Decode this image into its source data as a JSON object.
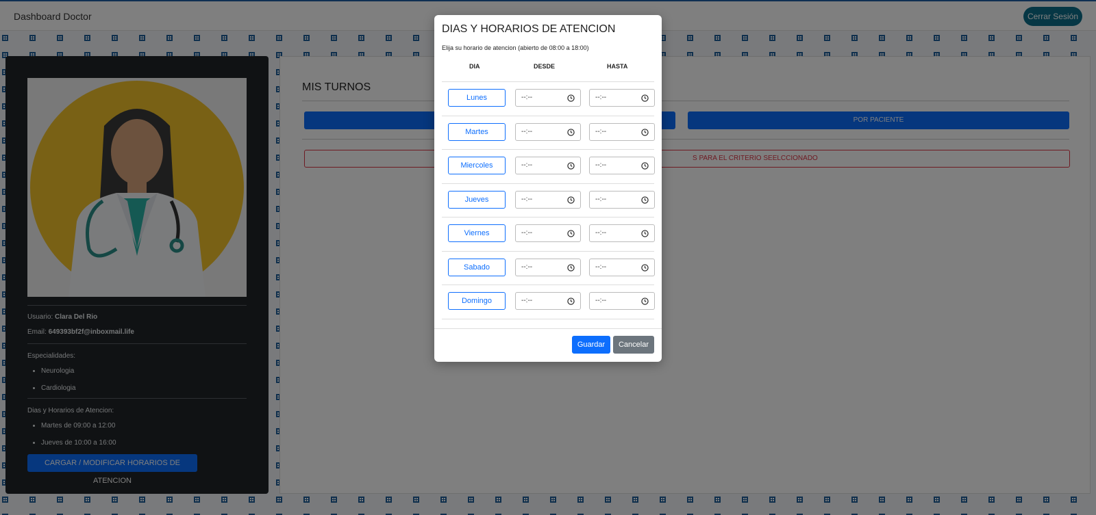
{
  "topbar": {
    "brand": "Dashboard Doctor",
    "logout_label": "Cerrar Sesión"
  },
  "profile": {
    "user_label": "Usuario:",
    "user_name": "Clara Del Rio",
    "email_label": "Email:",
    "email": "649393bf2f@inboxmail.life",
    "specialties_label": "Especialidades:",
    "specialties": [
      "Neurologia",
      "Cardiologia"
    ],
    "schedule_label": "Dias y Horarios de Atencion:",
    "schedules": [
      "Martes de 09:00 a 12:00",
      "Jueves de 10:00 a 16:00"
    ],
    "load_button": "CARGAR / MODIFICAR HORARIOS DE ATENCION"
  },
  "main": {
    "title": "MIS TURNOS",
    "by_patient_button": "POR PACIENTE",
    "alert_text": "S PARA EL CRITERIO SEELCCIONADO"
  },
  "modal": {
    "title": "DIAS Y HORARIOS DE ATENCION",
    "subtitle": "Elija su horario de atencion (abierto de 08:00 a 18:00)",
    "col_day": "DIA",
    "col_from": "DESDE",
    "col_to": "HASTA",
    "days": [
      "Lunes",
      "Martes",
      "Miercoles",
      "Jueves",
      "Viernes",
      "Sabado",
      "Domingo"
    ],
    "time_placeholder": "--:--",
    "save_label": "Guardar",
    "cancel_label": "Cancelar"
  },
  "colors": {
    "primary": "#0d6efd",
    "dark_card": "#212529",
    "danger": "#dc3545",
    "secondary": "#6c757d",
    "logout": "#0d6e8a"
  }
}
